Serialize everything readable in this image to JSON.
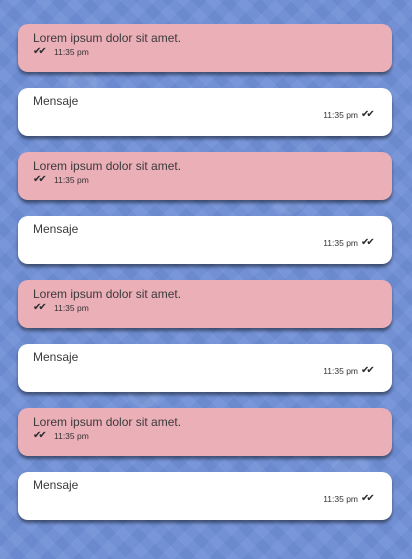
{
  "chat": {
    "messages": [
      {
        "direction": "incoming",
        "text": "Lorem ipsum dolor sit amet.",
        "time": "11:35 pm",
        "status_icon": "double-check"
      },
      {
        "direction": "outgoing",
        "text": "Mensaje",
        "time": "11:35 pm",
        "status_icon": "double-check"
      },
      {
        "direction": "incoming",
        "text": "Lorem ipsum dolor sit amet.",
        "time": "11:35 pm",
        "status_icon": "double-check"
      },
      {
        "direction": "outgoing",
        "text": "Mensaje",
        "time": "11:35 pm",
        "status_icon": "double-check"
      },
      {
        "direction": "incoming",
        "text": "Lorem ipsum dolor sit amet.",
        "time": "11:35 pm",
        "status_icon": "double-check"
      },
      {
        "direction": "outgoing",
        "text": "Mensaje",
        "time": "11:35 pm",
        "status_icon": "double-check"
      },
      {
        "direction": "incoming",
        "text": "Lorem ipsum dolor sit amet.",
        "time": "11:35 pm",
        "status_icon": "double-check"
      },
      {
        "direction": "outgoing",
        "text": "Mensaje",
        "time": "11:35 pm",
        "status_icon": "double-check"
      }
    ]
  },
  "colors": {
    "background": "#6f8fd6",
    "incoming_bubble": "#ebafb8",
    "outgoing_bubble": "#ffffff"
  }
}
